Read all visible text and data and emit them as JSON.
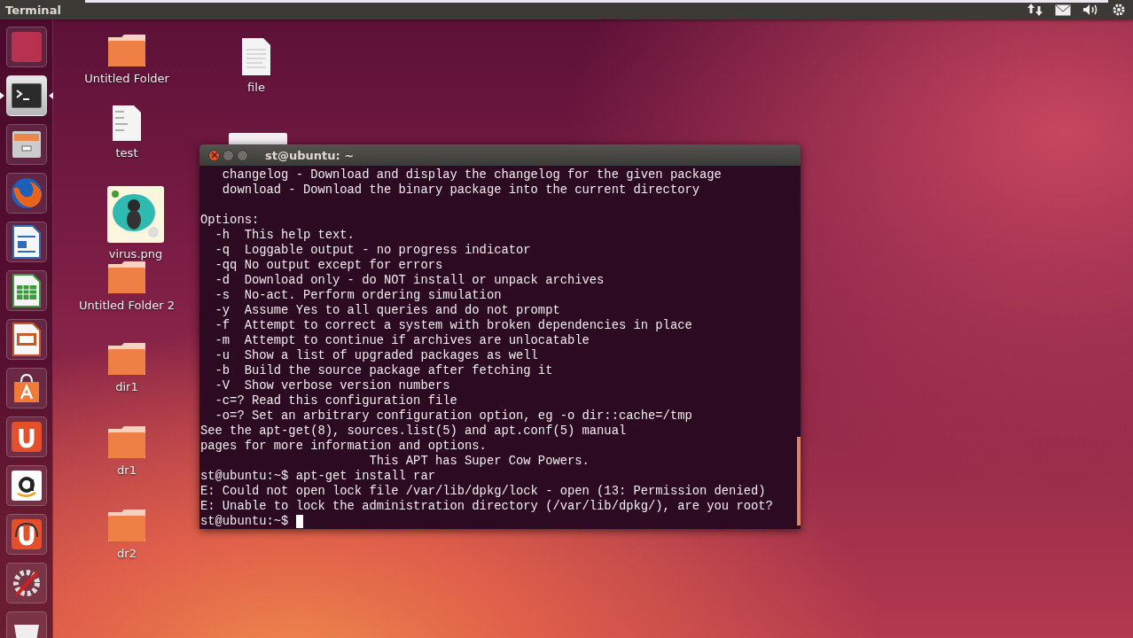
{
  "top_bar": {
    "title": "Terminal"
  },
  "launcher": [
    {
      "kind": "dash",
      "running": false
    },
    {
      "kind": "terminal",
      "running": true
    },
    {
      "kind": "files",
      "running": false
    },
    {
      "kind": "firefox",
      "running": false
    },
    {
      "kind": "writer",
      "running": false
    },
    {
      "kind": "calc",
      "running": false
    },
    {
      "kind": "impress",
      "running": false
    },
    {
      "kind": "store",
      "running": false
    },
    {
      "kind": "u1",
      "running": false
    },
    {
      "kind": "amazon",
      "running": false
    },
    {
      "kind": "u1music",
      "running": false
    },
    {
      "kind": "settings",
      "running": false
    },
    {
      "kind": "trash",
      "running": false
    }
  ],
  "desktop_icons": [
    {
      "kind": "folder",
      "label": "Untitled Folder"
    },
    {
      "kind": "document",
      "label": "file"
    },
    {
      "kind": "script",
      "label": "test"
    },
    {
      "kind": "picture",
      "label": "virus.png"
    },
    {
      "kind": "folder",
      "label": "Untitled Folder 2"
    },
    {
      "kind": "folder",
      "label": "dir1"
    },
    {
      "kind": "folder",
      "label": "dr1"
    },
    {
      "kind": "folder",
      "label": "dr2"
    }
  ],
  "terminal": {
    "title": "st@ubuntu: ~",
    "blocks": [
      [
        "   changelog - Download and display the changelog for the given package",
        "   download - Download the binary package into the current directory"
      ],
      [
        "Options:",
        "  -h  This help text.",
        "  -q  Loggable output - no progress indicator",
        "  -qq No output except for errors",
        "  -d  Download only - do NOT install or unpack archives",
        "  -s  No-act. Perform ordering simulation",
        "  -y  Assume Yes to all queries and do not prompt",
        "  -f  Attempt to correct a system with broken dependencies in place",
        "  -m  Attempt to continue if archives are unlocatable",
        "  -u  Show a list of upgraded packages as well",
        "  -b  Build the source package after fetching it",
        "  -V  Show verbose version numbers",
        "  -c=? Read this configuration file",
        "  -o=? Set an arbitrary configuration option, eg -o dir::cache=/tmp",
        "See the apt-get(8), sources.list(5) and apt.conf(5) manual",
        "pages for more information and options.",
        "                       This APT has Super Cow Powers.",
        "st@ubuntu:~$ apt-get install rar",
        "E: Could not open lock file /var/lib/dpkg/lock - open (13: Permission denied)",
        "E: Unable to lock the administration directory (/var/lib/dpkg/), are you root?"
      ]
    ],
    "prompt": "st@ubuntu:~$ "
  }
}
